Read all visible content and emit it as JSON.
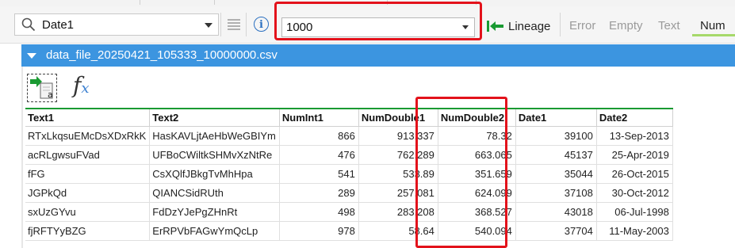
{
  "toolbar": {
    "field_select": {
      "value": "Date1",
      "icon": "search-icon"
    },
    "row_limit": {
      "value": "1000"
    },
    "lineage_label": "Lineage",
    "filters": [
      "Error",
      "Empty",
      "Text",
      "Num"
    ],
    "colors": {
      "highlight_red": "#e3121b",
      "num_underline": "#a6d96a",
      "lineage_green": "#1a9a32"
    }
  },
  "panel": {
    "title": "data_file_20250421_105333_10000000.csv",
    "header_color": "#3c95e0"
  },
  "table": {
    "columns": [
      "Text1",
      "Text2",
      "NumInt1",
      "NumDouble1",
      "NumDouble2",
      "Date1",
      "Date2"
    ],
    "numeric_columns": [
      2,
      3,
      4,
      5,
      6
    ],
    "rows": [
      [
        "RTxLkqsuEMcDsXDxRkK",
        "HasKAVLjtAeHbWeGBIYm",
        "866",
        "913.337",
        "78.32",
        "39100",
        "13-Sep-2013"
      ],
      [
        "acRLgwsuFVad",
        "UFBoCWiltkSHMvXzNtRe",
        "476",
        "762.289",
        "663.065",
        "45137",
        "25-Apr-2019"
      ],
      [
        "fFG",
        "CsXQlfJBkgTvMhHpa",
        "541",
        "533.89",
        "351.659",
        "35044",
        "26-Oct-2015"
      ],
      [
        "JGPkQd",
        "QIANCSidRUth",
        "289",
        "257.081",
        "624.099",
        "37108",
        "30-Oct-2012"
      ],
      [
        "sxUzGYvu",
        "FdDzYJePgZHnRt",
        "498",
        "283.208",
        "368.527",
        "43018",
        "06-Jul-1998"
      ],
      [
        "fjRFTYyBZG",
        "ErRPVbFAGwYmQcLp",
        "978",
        "58.64",
        "540.094",
        "37704",
        "11-May-2003"
      ]
    ]
  }
}
